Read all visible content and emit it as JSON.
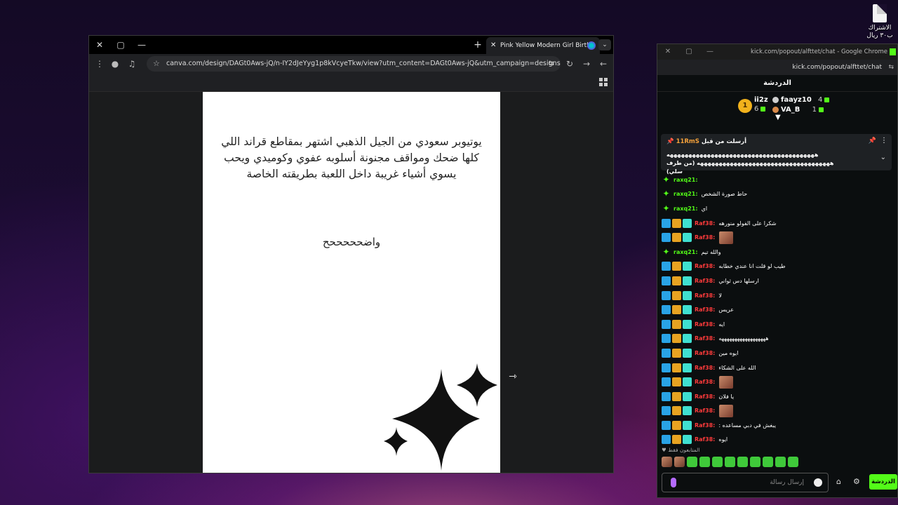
{
  "desktop": {
    "icon_label": "الاشتراك ب٣٠ ريال"
  },
  "canva_window": {
    "tab_title": "Pink Yellow Modern Girl Birthd",
    "url": "canva.com/design/DAGt0Aws-jQ/n-IY2dJeYyg1p8kVcyeTkw/view?utm_content=DAGt0Aws-jQ&utm_campaign=designshare&ut...",
    "page_text": "يوتيوبر سعودي من الجيل الذهبي اشتهر بمقاطع قراند اللي كلها ضحك ومواقف مجنونة أسلوبه عفوي وكوميدي ويحب يسوي أشياء غريبة داخل اللعبة بطريقته الخاصة",
    "page_subtext": "واضحححححح"
  },
  "kick_window": {
    "title": "kick.com/popout/alfttet/chat - Google Chrome",
    "url": "kick.com/popout/alfttet/chat",
    "header": "الدردشة",
    "leaderboard": {
      "rank": "1",
      "left_col": [
        {
          "name": "ii2z",
          "count": "6"
        }
      ],
      "right_col": [
        {
          "name": "faayz10",
          "count": "4"
        },
        {
          "name": "VA_B",
          "count": "1"
        }
      ]
    },
    "pinned": {
      "header_name": "11RmS",
      "header_suffix": "أرسلت من قبل",
      "line1": "ههههههههههههههههههههههههههههههههههههههههه",
      "line2": "ههههههههههههههههههههههههههههههههههههه (من طرف سلي)"
    },
    "messages": [
      {
        "user": "raxq21:",
        "text": "",
        "kind": "mod"
      },
      {
        "user": "raxq21:",
        "text": "حاط صورة الشخص",
        "kind": "mod"
      },
      {
        "user": "raxq21:",
        "text": "اي",
        "kind": "mod"
      },
      {
        "user": "Raf38:",
        "text": "شكرا على الفولو منورهه",
        "kind": "sub"
      },
      {
        "user": "Raf38:",
        "text": "",
        "kind": "sub",
        "emote": true
      },
      {
        "user": "raxq21:",
        "text": "والله تيم",
        "kind": "mod"
      },
      {
        "user": "Raf38:",
        "text": "طيب لو قلت انا عندي خطابه",
        "kind": "sub"
      },
      {
        "user": "Raf38:",
        "text": "ارسلها دس ثواني",
        "kind": "sub"
      },
      {
        "user": "Raf38:",
        "text": "لا",
        "kind": "sub"
      },
      {
        "user": "Raf38:",
        "text": "عريس",
        "kind": "sub"
      },
      {
        "user": "Raf38:",
        "text": "ايه",
        "kind": "sub"
      },
      {
        "user": "Raf38:",
        "text": "ههههههههههههههههههه",
        "kind": "sub"
      },
      {
        "user": "Raf38:",
        "text": "ايوه مين",
        "kind": "sub"
      },
      {
        "user": "Raf38:",
        "text": "الله على الشكاء",
        "kind": "sub"
      },
      {
        "user": "Raf38:",
        "text": "",
        "kind": "sub",
        "emote": true
      },
      {
        "user": "Raf38:",
        "text": "يا فلان",
        "kind": "sub"
      },
      {
        "user": "Raf38:",
        "text": "",
        "kind": "sub",
        "emote": true
      },
      {
        "user": "Raf38:",
        "text": "يبغش في دبي مساعده :",
        "kind": "sub"
      },
      {
        "user": "Raf38:",
        "text": "ايوه",
        "kind": "sub"
      }
    ],
    "followers_label": "المتابعون فقط",
    "input_placeholder": "إرسال رسالة",
    "chat_button": "الدردشة"
  }
}
